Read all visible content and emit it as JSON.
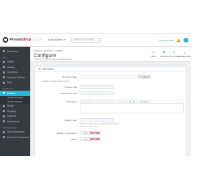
{
  "app": {
    "logo_main": "Presta",
    "logo_accent": "Shop",
    "version": "1.7.x",
    "quick_access": "Quick Access",
    "search_placeholder": "Search (e.g.: product)",
    "view_shop": "View my shop"
  },
  "sidebar": {
    "items_top": [
      {
        "label": "Dashboard",
        "active": false
      }
    ],
    "section_sell": "SELL",
    "items_sell": [
      {
        "label": "Orders"
      },
      {
        "label": "Catalog"
      },
      {
        "label": "Customers"
      },
      {
        "label": "Customer Service"
      },
      {
        "label": "Stats"
      }
    ],
    "section_improve": "IMPROVE",
    "items_improve": [
      {
        "label": "Modules",
        "active": true
      }
    ],
    "subitems": [
      "Module Manager",
      "Module Catalog"
    ],
    "items_more": [
      {
        "label": "Design"
      },
      {
        "label": "Shipping"
      },
      {
        "label": "Payment"
      },
      {
        "label": "International"
      }
    ],
    "section_configure": "CONFIGURE",
    "items_configure": [
      {
        "label": "Shop Parameters"
      },
      {
        "label": "Advanced Parameters"
      }
    ]
  },
  "header": {
    "breadcrumb": "Module  /  quantity  /  Configure",
    "title": "Configure",
    "subtitle": "Order with The Required Quantity Module",
    "actions": [
      {
        "label": "Back",
        "icon": "back-icon",
        "color": "#25b9d7"
      },
      {
        "label": "Translate",
        "icon": "flag-icon",
        "color": "#25b9d7"
      },
      {
        "label": "Check update",
        "icon": "refresh-icon",
        "color": "#25b9d7"
      },
      {
        "label": "Manage hooks",
        "icon": "download-icon",
        "color": "#70b580"
      }
    ]
  },
  "panel": {
    "title": "SETTINGS",
    "image_label": "* Product Image",
    "add_file": "Add file",
    "image_help": "Upload an image of the product",
    "title_label": "* Product Title",
    "title_value": "",
    "subtitle_label": "* Product Sub Title",
    "subtitle_value": "",
    "description_label": "Description",
    "toolbar_buttons": [
      "B",
      "I",
      "U",
      "S",
      "x²",
      "x₂",
      "≡",
      "≡",
      "≡",
      "≡",
      "•",
      "1.",
      "⇤",
      "⇥",
      "A",
      "A",
      "¶",
      "🔗",
      "▦",
      "<>",
      "Paragraph"
    ],
    "specific_label": "Specific Json",
    "specific_help": "Set the specific json to compute the quantity of products in the order",
    "visible_label": "Display in description",
    "status_label": "Status",
    "yes_label": "YES",
    "no_label": "NO"
  },
  "colors": {
    "accent": "#25b9d7",
    "sidebar": "#363a41",
    "no_toggle": "#e08f95",
    "brand": "#df0067"
  }
}
